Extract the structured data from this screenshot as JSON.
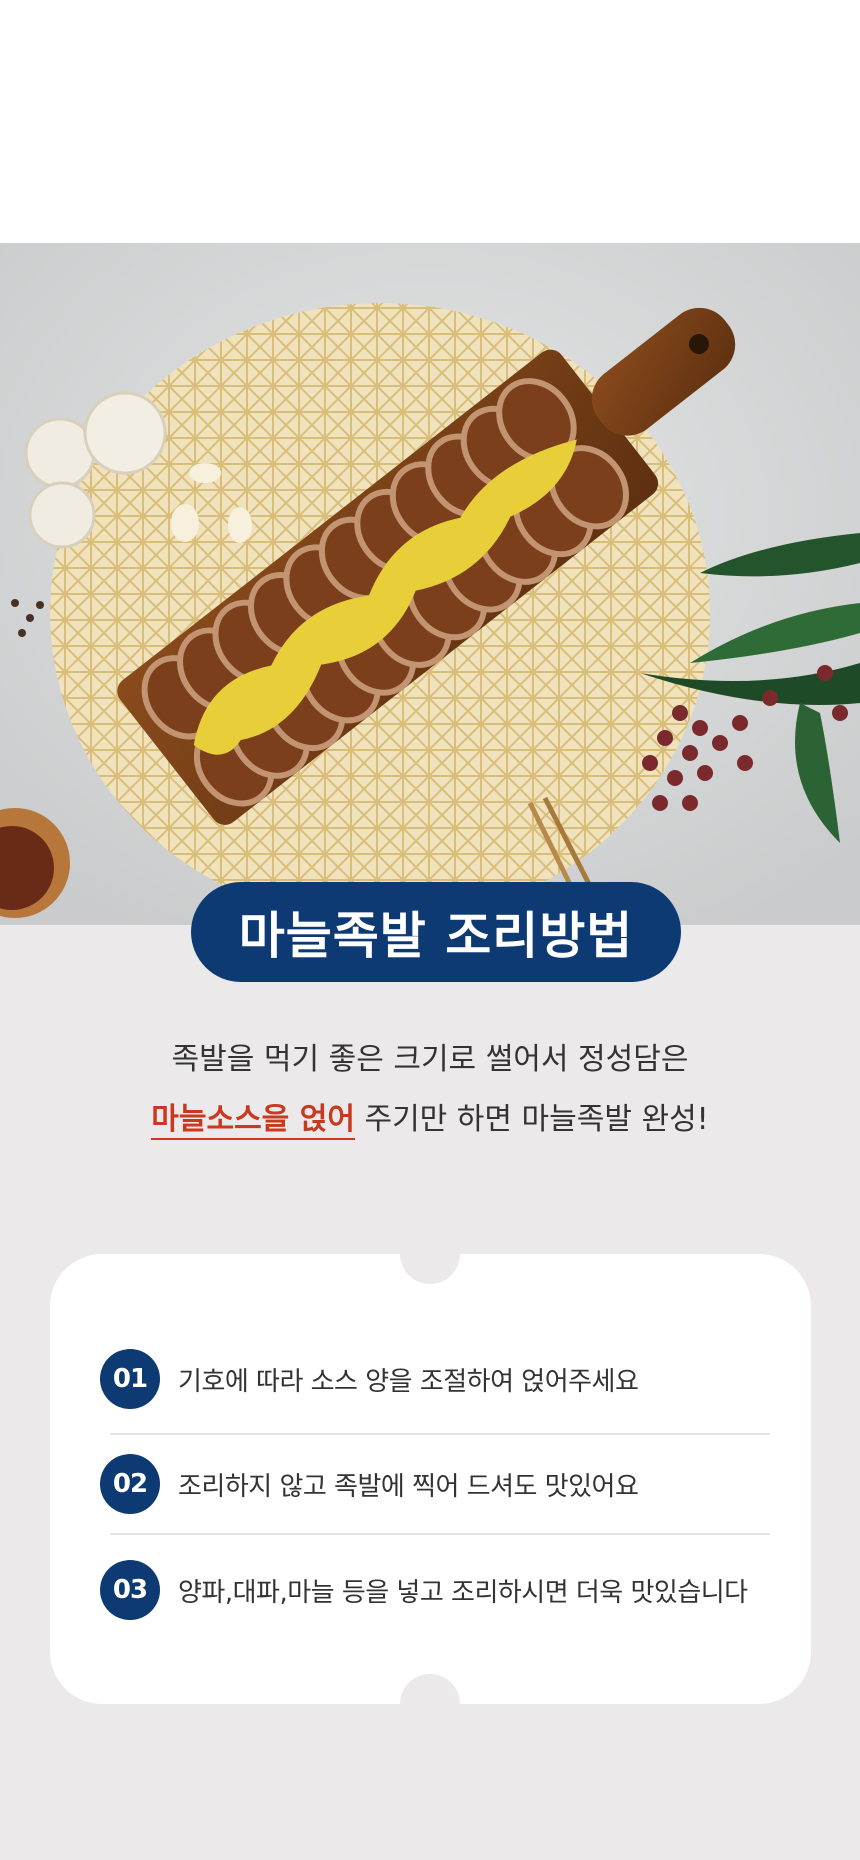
{
  "title": "마늘족발 조리방법",
  "description": {
    "line1": "족발을 먹기 좋은 크기로 썰어서 정성담은",
    "highlight": "마늘소스을 얹어",
    "line2_rest": " 주기만 하면 마늘족발 완성!"
  },
  "steps": [
    {
      "num": "01",
      "text": "기호에 따라 소스 양을 조절하여 얹어주세요"
    },
    {
      "num": "02",
      "text": "조리하지 않고 족발에 찍어 드셔도 맛있어요"
    },
    {
      "num": "03",
      "text": "양파,대파,마늘 등을 넣고 조리하시면 더욱 맛있습니다"
    }
  ],
  "colors": {
    "navy": "#0d3a73",
    "highlight_red": "#c8391f",
    "background": "#ebe9ea",
    "sauce_yellow": "#e8cf3a"
  }
}
